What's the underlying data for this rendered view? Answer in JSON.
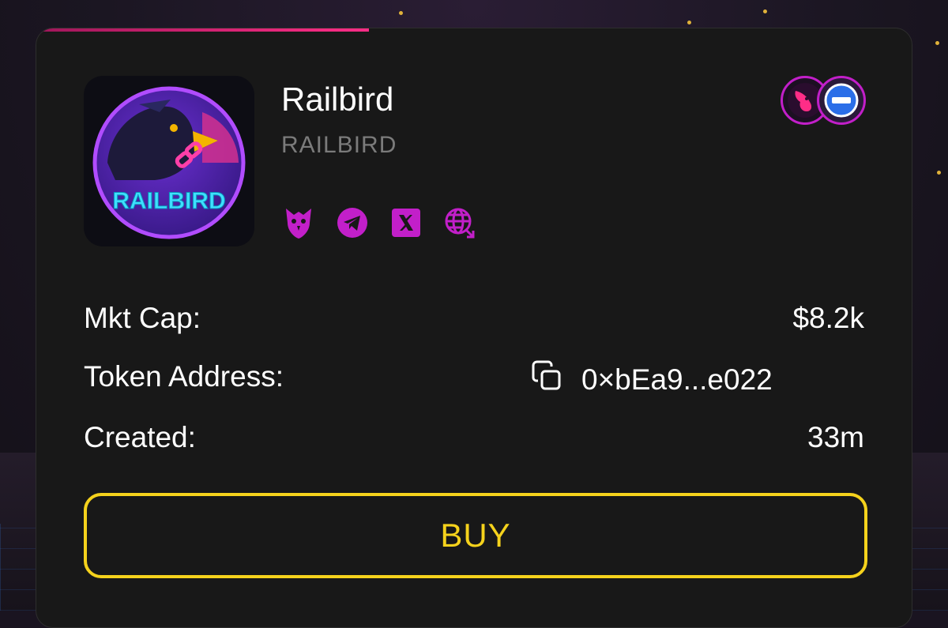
{
  "token": {
    "name": "Railbird",
    "ticker": "RAILBIRD",
    "logo_text": "RAILBIRD"
  },
  "socials": [
    {
      "icon": "owl-icon"
    },
    {
      "icon": "telegram-icon"
    },
    {
      "icon": "x-icon"
    },
    {
      "icon": "website-icon"
    }
  ],
  "badges": [
    {
      "icon": "uniswap-icon"
    },
    {
      "icon": "chain-icon"
    }
  ],
  "stats": {
    "market_cap_label": "Mkt Cap:",
    "market_cap_value": "$8.2k",
    "token_address_label": "Token Address:",
    "token_address_value": "0×bEa9...e022",
    "created_label": "Created:",
    "created_value": "33m"
  },
  "buy_label": "BUY",
  "colors": {
    "accent": "#c21fc9",
    "buy": "#f5d21c",
    "card": "#181818",
    "progress": "#ff2d87"
  },
  "bonding_progress": 0.38
}
